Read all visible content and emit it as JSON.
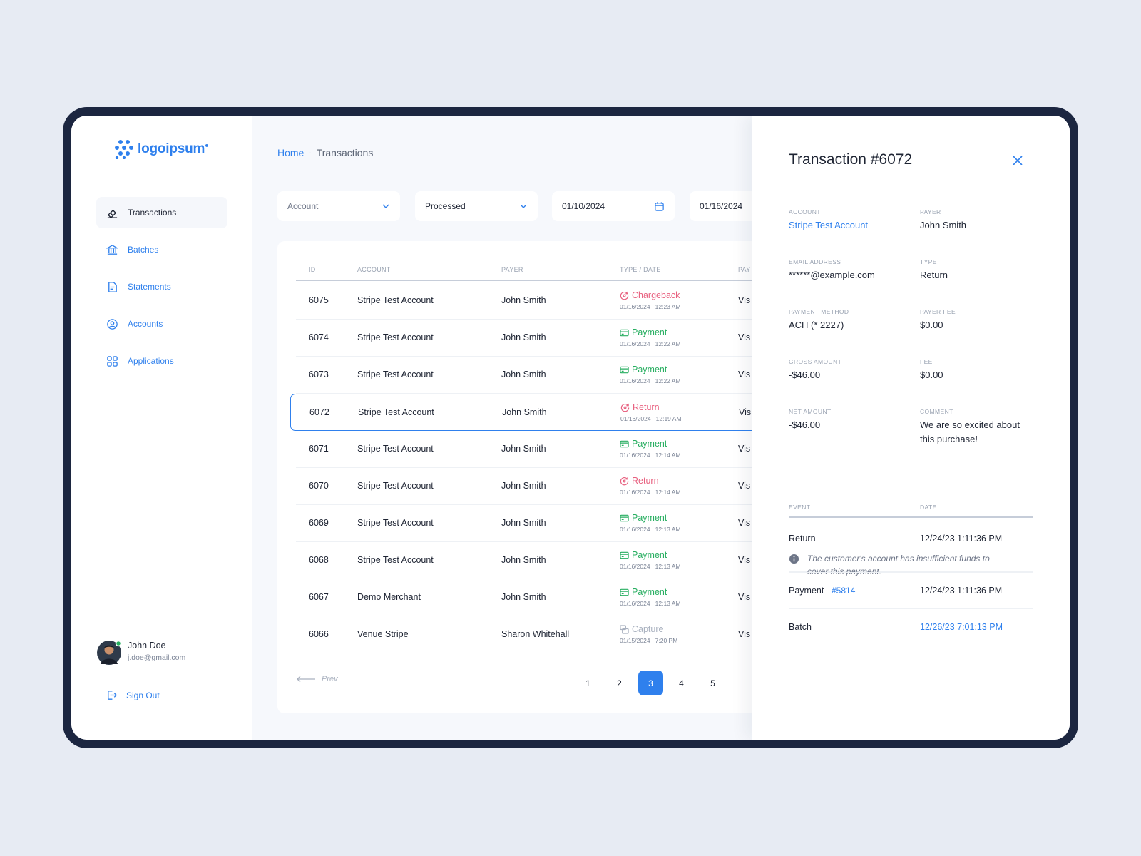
{
  "brand": {
    "name": "logoipsum"
  },
  "sidebar": {
    "items": [
      {
        "label": "Transactions",
        "icon": "transactions-icon"
      },
      {
        "label": "Batches",
        "icon": "bank-icon"
      },
      {
        "label": "Statements",
        "icon": "document-icon"
      },
      {
        "label": "Accounts",
        "icon": "user-circle-icon"
      },
      {
        "label": "Applications",
        "icon": "grid-icon"
      }
    ],
    "user": {
      "name": "John Doe",
      "email": "j.doe@gmail.com"
    },
    "signout": "Sign Out"
  },
  "breadcrumb": {
    "home": "Home",
    "separator": "·",
    "current": "Transactions"
  },
  "filters": {
    "account": "Account",
    "status": "Processed",
    "date_from": "01/10/2024",
    "date_to": "01/16/2024"
  },
  "table": {
    "headers": {
      "id": "ID",
      "account": "ACCOUNT",
      "payer": "PAYER",
      "type_date": "TYPE / DATE",
      "pay": "PAY"
    },
    "rows": [
      {
        "id": "6075",
        "account": "Stripe Test Account",
        "payer": "John Smith",
        "type": "Chargeback",
        "date": "01/16/2024   12:23 AM",
        "pay": "Vis"
      },
      {
        "id": "6074",
        "account": "Stripe Test Account",
        "payer": "John Smith",
        "type": "Payment",
        "date": "01/16/2024   12:22 AM",
        "pay": "Vis"
      },
      {
        "id": "6073",
        "account": "Stripe Test Account",
        "payer": "John Smith",
        "type": "Payment",
        "date": "01/16/2024   12:22 AM",
        "pay": "Vis"
      },
      {
        "id": "6072",
        "account": "Stripe Test Account",
        "payer": "John Smith",
        "type": "Return",
        "date": "01/16/2024   12:19 AM",
        "pay": "Vis"
      },
      {
        "id": "6071",
        "account": "Stripe Test Account",
        "payer": "John Smith",
        "type": "Payment",
        "date": "01/16/2024   12:14 AM",
        "pay": "Vis"
      },
      {
        "id": "6070",
        "account": "Stripe Test Account",
        "payer": "John Smith",
        "type": "Return",
        "date": "01/16/2024   12:14 AM",
        "pay": "Vis"
      },
      {
        "id": "6069",
        "account": "Stripe Test Account",
        "payer": "John Smith",
        "type": "Payment",
        "date": "01/16/2024   12:13 AM",
        "pay": "Vis"
      },
      {
        "id": "6068",
        "account": "Stripe Test Account",
        "payer": "John Smith",
        "type": "Payment",
        "date": "01/16/2024   12:13 AM",
        "pay": "Vis"
      },
      {
        "id": "6067",
        "account": "Demo Merchant",
        "payer": "John Smith",
        "type": "Payment",
        "date": "01/16/2024   12:13 AM",
        "pay": "Vis"
      },
      {
        "id": "6066",
        "account": "Venue Stripe",
        "payer": "Sharon Whitehall",
        "type": "Capture",
        "date": "01/15/2024   7:20 PM",
        "pay": "Vis"
      }
    ]
  },
  "pagination": {
    "prev": "Prev",
    "pages": [
      "1",
      "2",
      "3",
      "4",
      "5"
    ],
    "current": "3"
  },
  "detail": {
    "title": "Transaction #6072",
    "fields": {
      "account_label": "ACCOUNT",
      "account": "Stripe Test Account",
      "payer_label": "PAYER",
      "payer": "John Smith",
      "email_label": "EMAIL ADDRESS",
      "email": "******@example.com",
      "type_label": "TYPE",
      "type": "Return",
      "method_label": "PAYMENT METHOD",
      "method": "ACH (* 2227)",
      "payer_fee_label": "PAYER FEE",
      "payer_fee": "$0.00",
      "gross_label": "GROSS AMOUNT",
      "gross": "-$46.00",
      "fee_label": "FEE",
      "fee": "$0.00",
      "net_label": "NET AMOUNT",
      "net": "-$46.00",
      "comment_label": "COMMENT",
      "comment_line1": "We are so excited about",
      "comment_line2": "this purchase!"
    },
    "events": {
      "event_header": "EVENT",
      "date_header": "DATE",
      "return_event": "Return",
      "return_date": "12/24/23 1:11:36 PM",
      "return_note_line1": "The customer's account has insufficient funds to",
      "return_note_line2": "cover this payment.",
      "payment_event": "Payment",
      "payment_link": "#5814",
      "payment_date": "12/24/23 1:11:36 PM",
      "batch_event": "Batch",
      "batch_date": "12/26/23 7:01:13 PM"
    }
  },
  "colors": {
    "accent": "#2f80ed",
    "success": "#27ae60",
    "danger": "#e8607f",
    "frame": "#1c2640"
  }
}
